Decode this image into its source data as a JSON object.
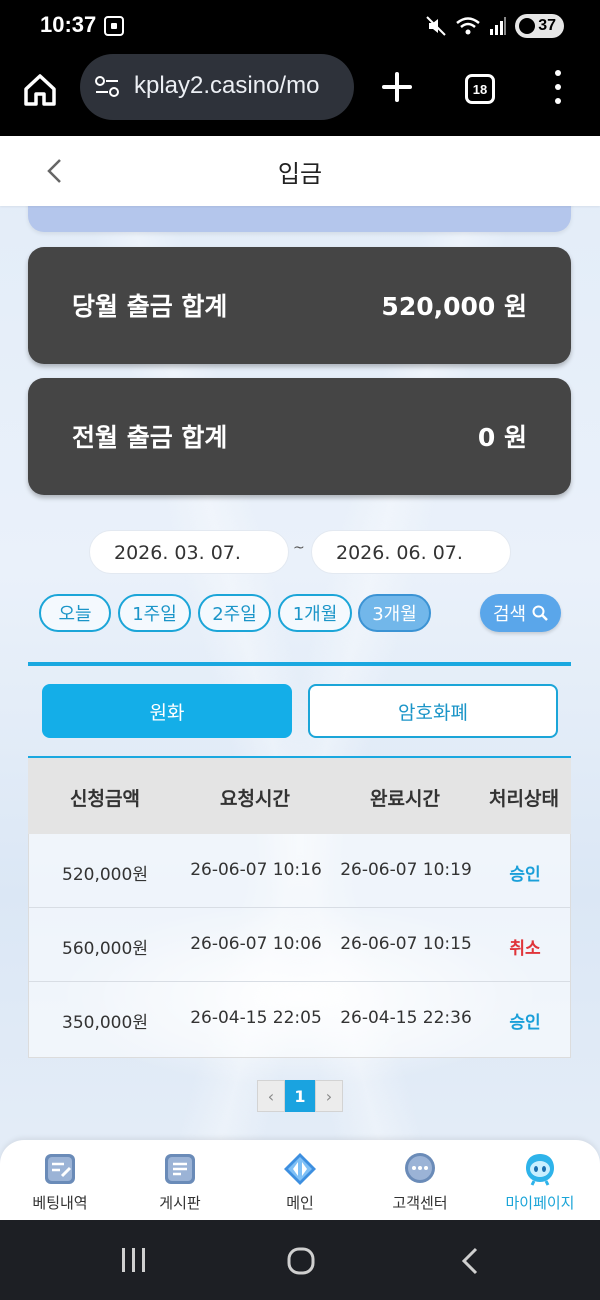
{
  "status_bar": {
    "time": "10:37",
    "battery": "37"
  },
  "browser": {
    "url": "kplay2.casino/mo",
    "tab_count": "18"
  },
  "header": {
    "title": "입금"
  },
  "summary": [
    {
      "label": "당월 출금 합계",
      "value": "520,000 원"
    },
    {
      "label": "전월 출금 합계",
      "value": "0 원"
    }
  ],
  "filter": {
    "start_date": "2026. 03. 07.",
    "separator": "~",
    "end_date": "2026. 06. 07.",
    "periods": [
      "오늘",
      "1주일",
      "2주일",
      "1개월",
      "3개월"
    ],
    "active_period": "3개월",
    "search_label": "검색"
  },
  "currency_tabs": {
    "won": "원화",
    "crypto": "암호화폐",
    "active": "원화"
  },
  "table": {
    "headers": [
      "신청금액",
      "요청시간",
      "완료시간",
      "처리상태"
    ],
    "rows": [
      {
        "amount": "520,000원",
        "requested": "26-06-07 10:16",
        "completed": "26-06-07 10:19",
        "status": "승인"
      },
      {
        "amount": "560,000원",
        "requested": "26-06-07 10:06",
        "completed": "26-06-07 10:15",
        "status": "취소"
      },
      {
        "amount": "350,000원",
        "requested": "26-04-15 22:05",
        "completed": "26-04-15 22:36",
        "status": "승인"
      }
    ]
  },
  "pagination": {
    "prev": "‹",
    "current": "1",
    "next": "›"
  },
  "bottom_nav": [
    {
      "label": "베팅내역",
      "icon": "betting-history-icon"
    },
    {
      "label": "게시판",
      "icon": "board-icon"
    },
    {
      "label": "메인",
      "icon": "main-icon"
    },
    {
      "label": "고객센터",
      "icon": "customer-center-icon"
    },
    {
      "label": "마이페이지",
      "icon": "mypage-icon",
      "active": true
    }
  ],
  "colors": {
    "accent": "#1aa8e0",
    "approved": "#1a9fd9",
    "cancelled": "#e0343a",
    "card": "#454545"
  }
}
